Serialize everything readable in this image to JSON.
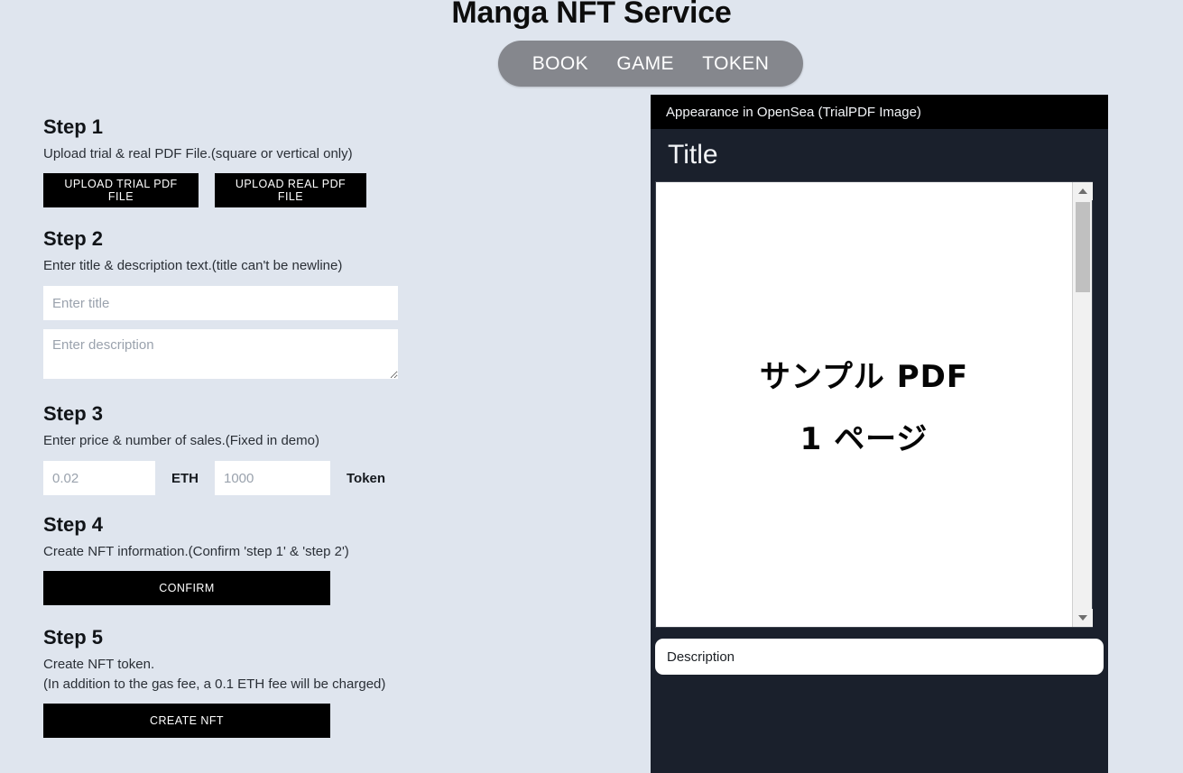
{
  "header": {
    "title": "Manga NFT Service",
    "nav": [
      {
        "label": "BOOK",
        "name": "nav-book"
      },
      {
        "label": "GAME",
        "name": "nav-game"
      },
      {
        "label": "TOKEN",
        "name": "nav-token"
      }
    ],
    "nav_background": "#85878d"
  },
  "theme": {
    "page_background": "#dfe5ee",
    "panel_background": "#1a202c",
    "panel_bar_background": "#000000",
    "button_background": "#000000",
    "button_text": "#ffffff"
  },
  "steps": [
    {
      "heading": "Step 1",
      "description": "Upload trial & real PDF File.(square or vertical only)",
      "buttons": [
        {
          "label": "UPLOAD TRIAL PDF FILE",
          "name": "upload-trial-pdf-button"
        },
        {
          "label": "UPLOAD REAL PDF FILE",
          "name": "upload-real-pdf-button"
        }
      ]
    },
    {
      "heading": "Step 2",
      "description": "Enter title & description text.(title can't be newline)",
      "title_placeholder": "Enter title",
      "title_value": "",
      "description_placeholder": "Enter description",
      "description_value": ""
    },
    {
      "heading": "Step 3",
      "description": "Enter price & number of sales.(Fixed in demo)",
      "price_placeholder": "0.02",
      "price_value": "",
      "price_unit": "ETH",
      "count_placeholder": "1000",
      "count_value": "",
      "count_unit": "Token"
    },
    {
      "heading": "Step 4",
      "description": "Create NFT information.(Confirm 'step 1' & 'step 2')",
      "button_label": "CONFIRM"
    },
    {
      "heading": "Step 5",
      "description_line1": "Create NFT token.",
      "description_line2": "(In addition to the gas fee, a 0.1 ETH fee will be charged)",
      "button_label": "CREATE NFT"
    }
  ],
  "preview": {
    "bar_label": "Appearance in OpenSea (TrialPDF Image)",
    "nft_title": "Title",
    "pdf_line1": "サンプル PDF",
    "pdf_line2": "1 ページ",
    "description_label": "Description",
    "scrollbar": {
      "up_arrow": "scroll-up-arrow",
      "down_arrow": "scroll-down-arrow",
      "thumb": "scroll-thumb"
    }
  }
}
